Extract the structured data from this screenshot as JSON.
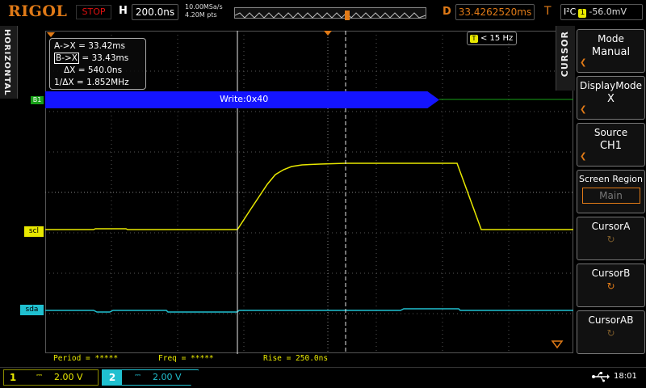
{
  "topbar": {
    "brand": "RIGOL",
    "run_state": "STOP",
    "horizontal_label": "H",
    "timebase": "200.0ns",
    "sample_rate": "10.00MSa/s",
    "memory_depth": "4.20M pts",
    "delay_label": "D",
    "delay_value": "33.4262520ms",
    "trigger_label": "T",
    "trigger_type": "I²C",
    "trigger_source": "1",
    "trigger_level": "-56.0mV"
  },
  "left_tab": {
    "label": "HORIZONTAL"
  },
  "cursor_readout": {
    "ax": "A->X = 33.42ms",
    "bx_prefix": "B->X",
    "bx_value": "= 33.43ms",
    "dx": "ΔX = 540.0ns",
    "inv_dx": "1/ΔX = 1.852MHz"
  },
  "trigger_freq": {
    "icon_letter": "T",
    "value": "< 15 Hz"
  },
  "bus": {
    "tag": "B1",
    "decode_text": "Write:0x40"
  },
  "channels": {
    "scl_tag": "scl",
    "sda_tag": "sda",
    "scl_color": "#e8e800",
    "sda_color": "#20c0d0",
    "bus_color": "#1414ff"
  },
  "measurements": {
    "period": "Period = *****",
    "freq": "Freq = *****",
    "rise": "Rise = 250.0ns"
  },
  "bottombar": {
    "ch1_num": "1",
    "ch1_coupling": "⎓",
    "ch1_scale": "2.00 V",
    "ch2_num": "2",
    "ch2_coupling": "⎓",
    "ch2_scale": "2.00 V",
    "usb_icon": "usb-icon",
    "time": "18:01"
  },
  "menu": {
    "tab_label": "CURSOR",
    "mode_title": "Mode",
    "mode_value": "Manual",
    "display_title": "DisplayMode",
    "display_value": "X",
    "source_title": "Source",
    "source_value": "CH1",
    "screen_title": "Screen Region",
    "screen_value": "Main",
    "cursor_a": "CursorA",
    "cursor_b": "CursorB",
    "cursor_ab": "CursorAB"
  }
}
